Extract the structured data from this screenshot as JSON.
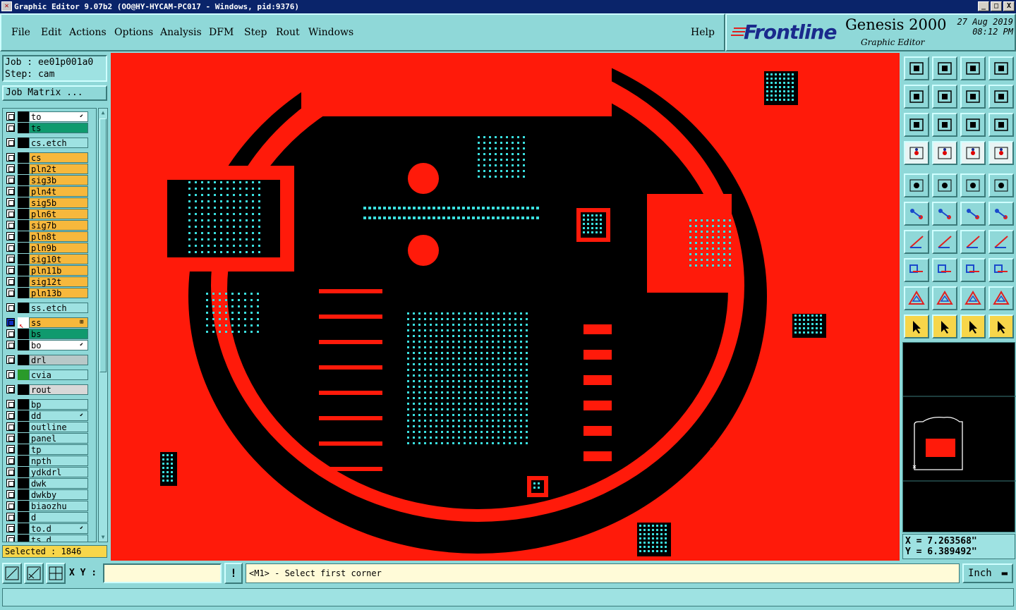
{
  "window": {
    "title": "Graphic Editor 9.07b2 (OO@HY-HYCAM-PC017 - Windows, pid:9376)",
    "min": "_",
    "max": "□",
    "close": "X"
  },
  "menu": {
    "items": [
      "File",
      "Edit",
      "Actions",
      "Options",
      "Analysis",
      "DFM",
      "Step",
      "Rout",
      "Windows"
    ],
    "help": "Help"
  },
  "brand": {
    "logo": "Frontline",
    "product": "Genesis 2000",
    "subtitle": "Graphic Editor",
    "date": "27 Aug 2019",
    "time": "08:12 PM"
  },
  "job": {
    "job_line": "Job : ee01p001a0",
    "step_line": "Step: cam",
    "matrix_button": "Job Matrix ..."
  },
  "layers": [
    {
      "name": "to",
      "color": "#ffffff",
      "flag": "⬋"
    },
    {
      "name": "ts",
      "color": "#0f9a6e",
      "flag": ""
    },
    {
      "name": "cs.etch",
      "color": "#9ee2e2",
      "flag": ""
    },
    {
      "name": "cs",
      "color": "#f7b83c",
      "flag": ""
    },
    {
      "name": "pln2t",
      "color": "#f7b83c",
      "flag": ""
    },
    {
      "name": "sig3b",
      "color": "#f7b83c",
      "flag": ""
    },
    {
      "name": "pln4t",
      "color": "#f7b83c",
      "flag": ""
    },
    {
      "name": "sig5b",
      "color": "#f7b83c",
      "flag": ""
    },
    {
      "name": "pln6t",
      "color": "#f7b83c",
      "flag": ""
    },
    {
      "name": "sig7b",
      "color": "#f7b83c",
      "flag": ""
    },
    {
      "name": "pln8t",
      "color": "#f7b83c",
      "flag": ""
    },
    {
      "name": "pln9b",
      "color": "#f7b83c",
      "flag": ""
    },
    {
      "name": "sig10t",
      "color": "#f7b83c",
      "flag": ""
    },
    {
      "name": "pln11b",
      "color": "#f7b83c",
      "flag": ""
    },
    {
      "name": "sig12t",
      "color": "#f7b83c",
      "flag": ""
    },
    {
      "name": "pln13b",
      "color": "#f7b83c",
      "flag": ""
    },
    {
      "name": "ss.etch",
      "color": "#9ee2e2",
      "flag": ""
    },
    {
      "name": "ss",
      "color": "#f7b83c",
      "flag": "⊞"
    },
    {
      "name": "bs",
      "color": "#0f9a6e",
      "flag": ""
    },
    {
      "name": "bo",
      "color": "#ffffff",
      "flag": "⬋"
    },
    {
      "name": "drl",
      "color": "#b8c8c8",
      "flag": ""
    },
    {
      "name": "cvia",
      "color": "#9ee2e2",
      "flag": ""
    },
    {
      "name": "rout",
      "color": "#d8d8d8",
      "flag": ""
    },
    {
      "name": "bp",
      "color": "#9ee2e2",
      "flag": ""
    },
    {
      "name": "dd",
      "color": "#9ee2e2",
      "flag": "⬋"
    },
    {
      "name": "outline",
      "color": "#9ee2e2",
      "flag": ""
    },
    {
      "name": "panel",
      "color": "#9ee2e2",
      "flag": ""
    },
    {
      "name": "tp",
      "color": "#9ee2e2",
      "flag": ""
    },
    {
      "name": "npth",
      "color": "#9ee2e2",
      "flag": ""
    },
    {
      "name": "ydkdrl",
      "color": "#9ee2e2",
      "flag": ""
    },
    {
      "name": "dwk",
      "color": "#9ee2e2",
      "flag": ""
    },
    {
      "name": "dwkby",
      "color": "#9ee2e2",
      "flag": ""
    },
    {
      "name": "biaozhu",
      "color": "#9ee2e2",
      "flag": ""
    },
    {
      "name": "d",
      "color": "#9ee2e2",
      "flag": ""
    },
    {
      "name": "to.d",
      "color": "#9ee2e2",
      "flag": "⬋"
    },
    {
      "name": "ts.d",
      "color": "#9ee2e2",
      "flag": ""
    }
  ],
  "selected": "Selected : 1846",
  "coords": {
    "x": "X = 7.263568\"",
    "y": "Y = 6.389492\""
  },
  "bottom": {
    "xy_label": "X Y :",
    "xy_value": "",
    "message": "<M1> - Select first corner",
    "unit": "Inch"
  },
  "colors": {
    "board": "#ff1a0a",
    "pad": "#3ae0e0",
    "bg": "#000000",
    "ui": "#8fd8d8"
  }
}
